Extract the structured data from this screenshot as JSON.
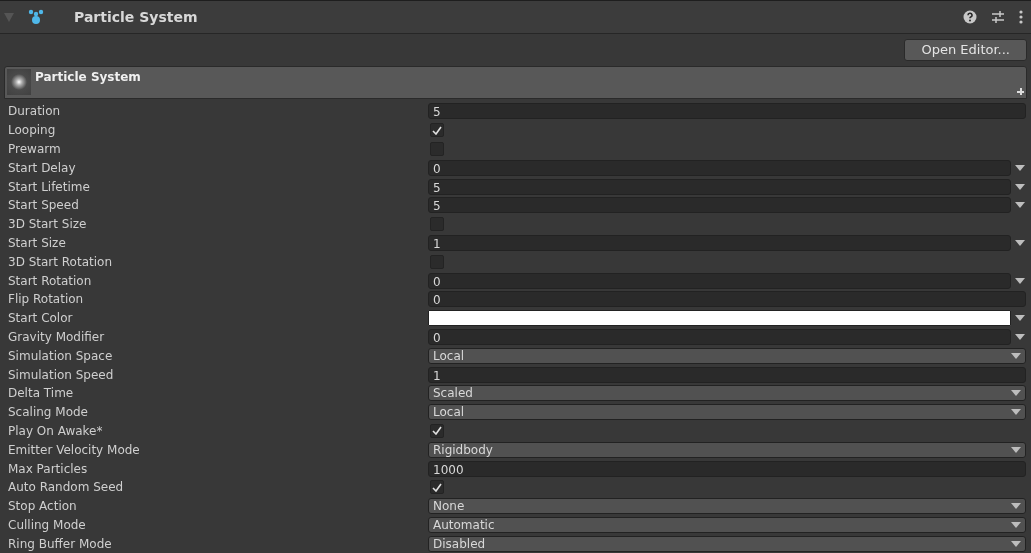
{
  "component": {
    "title": "Particle System",
    "expanded": true
  },
  "open_editor": "Open Editor...",
  "module": {
    "title": "Particle System"
  },
  "properties": [
    {
      "label": "Duration",
      "kind": "field",
      "value": "5"
    },
    {
      "label": "Looping",
      "kind": "checkbox",
      "checked": true
    },
    {
      "label": "Prewarm",
      "kind": "checkbox",
      "checked": false
    },
    {
      "label": "Start Delay",
      "kind": "curve",
      "value": "0"
    },
    {
      "label": "Start Lifetime",
      "kind": "curve",
      "value": "5"
    },
    {
      "label": "Start Speed",
      "kind": "curve",
      "value": "5"
    },
    {
      "label": "3D Start Size",
      "kind": "checkbox",
      "checked": false
    },
    {
      "label": "Start Size",
      "kind": "curve",
      "value": "1"
    },
    {
      "label": "3D Start Rotation",
      "kind": "checkbox",
      "checked": false
    },
    {
      "label": "Start Rotation",
      "kind": "curve",
      "value": "0"
    },
    {
      "label": "Flip Rotation",
      "kind": "field",
      "value": "0"
    },
    {
      "label": "Start Color",
      "kind": "color",
      "color": "#ffffff"
    },
    {
      "label": "Gravity Modifier",
      "kind": "curve",
      "value": "0"
    },
    {
      "label": "Simulation Space",
      "kind": "dropdown",
      "value": "Local"
    },
    {
      "label": "Simulation Speed",
      "kind": "field",
      "value": "1"
    },
    {
      "label": "Delta Time",
      "kind": "dropdown",
      "value": "Scaled"
    },
    {
      "label": "Scaling Mode",
      "kind": "dropdown",
      "value": "Local"
    },
    {
      "label": "Play On Awake*",
      "kind": "checkbox",
      "checked": true
    },
    {
      "label": "Emitter Velocity Mode",
      "kind": "dropdown",
      "value": "Rigidbody"
    },
    {
      "label": "Max Particles",
      "kind": "field",
      "value": "1000"
    },
    {
      "label": "Auto Random Seed",
      "kind": "checkbox",
      "checked": true
    },
    {
      "label": "Stop Action",
      "kind": "dropdown",
      "value": "None"
    },
    {
      "label": "Culling Mode",
      "kind": "dropdown",
      "value": "Automatic"
    },
    {
      "label": "Ring Buffer Mode",
      "kind": "dropdown",
      "value": "Disabled"
    }
  ]
}
